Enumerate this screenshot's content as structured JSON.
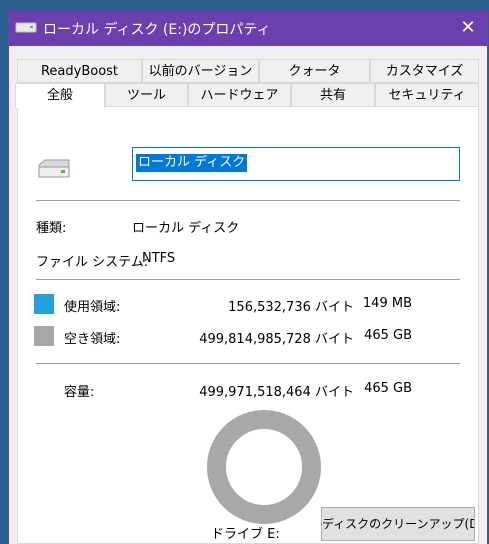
{
  "window": {
    "title": "ローカル ディスク (E:)のプロパティ",
    "close_glyph": "✕"
  },
  "tabs_row1": [
    {
      "label": "ReadyBoost"
    },
    {
      "label": "以前のバージョン"
    },
    {
      "label": "クォータ"
    },
    {
      "label": "カスタマイズ"
    }
  ],
  "tabs_row2": [
    {
      "label": "全般",
      "active": true
    },
    {
      "label": "ツール"
    },
    {
      "label": "ハードウェア"
    },
    {
      "label": "共有"
    },
    {
      "label": "セキュリティ"
    }
  ],
  "general": {
    "name_value": "ローカル ディスク",
    "type_label": "種類:",
    "type_value": "ローカル ディスク",
    "fs_label": "ファイル システム:",
    "fs_value": "NTFS",
    "used": {
      "label": "使用領域:",
      "bytes": "156,532,736 バイト",
      "size": "149 MB",
      "color": "#26a0da"
    },
    "free": {
      "label": "空き領域:",
      "bytes": "499,814,985,728 バイト",
      "size": "465 GB",
      "color": "#a8a8a8"
    },
    "capacity": {
      "label": "容量:",
      "bytes": "499,971,518,464 バイト",
      "size": "465 GB"
    },
    "usage_fraction": 0.0003,
    "drive_label": "ドライブ E:",
    "cleanup_button": "ディスクのクリーンアップ(D)"
  },
  "icons": [
    "drive-icon",
    "close-icon"
  ]
}
